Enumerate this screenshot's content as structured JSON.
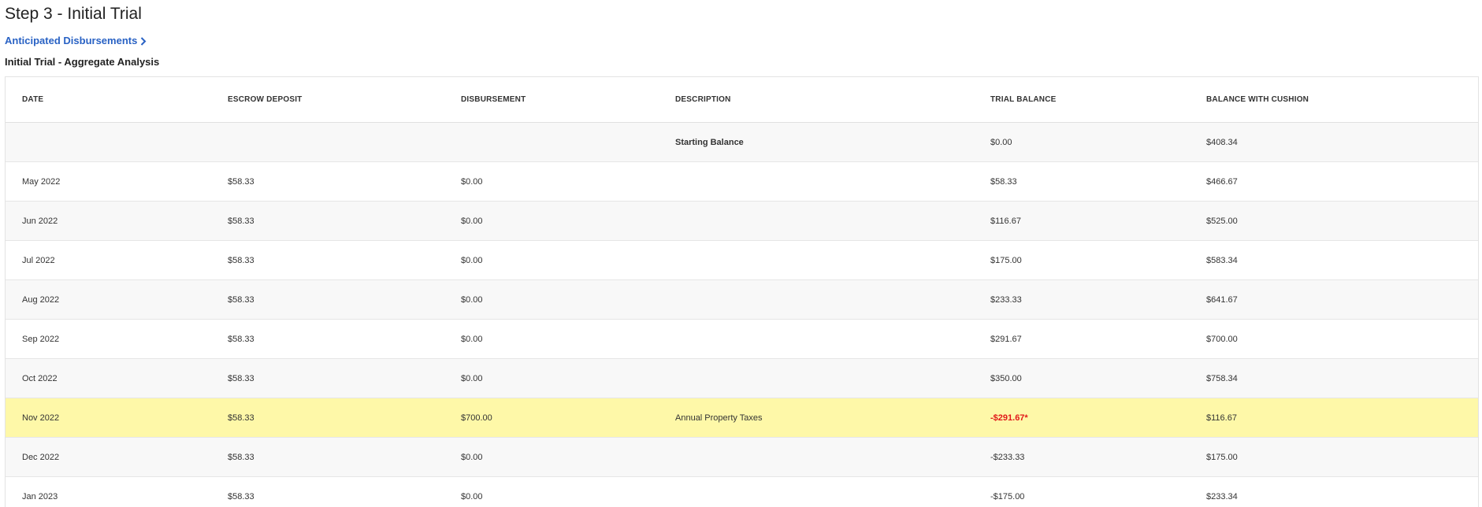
{
  "header": {
    "step_title": "Step 3 - Initial Trial",
    "link_label": "Anticipated Disbursements",
    "section_title": "Initial Trial - Aggregate Analysis"
  },
  "table": {
    "columns": [
      "DATE",
      "ESCROW DEPOSIT",
      "DISBURSEMENT",
      "DESCRIPTION",
      "TRIAL BALANCE",
      "BALANCE WITH CUSHION"
    ],
    "rows": [
      {
        "date": "",
        "deposit": "",
        "disbursement": "",
        "description": "Starting Balance",
        "trial_balance": "$0.00",
        "cushion": "$408.34"
      },
      {
        "date": "May 2022",
        "deposit": "$58.33",
        "disbursement": "$0.00",
        "description": "",
        "trial_balance": "$58.33",
        "cushion": "$466.67"
      },
      {
        "date": "Jun 2022",
        "deposit": "$58.33",
        "disbursement": "$0.00",
        "description": "",
        "trial_balance": "$116.67",
        "cushion": "$525.00"
      },
      {
        "date": "Jul 2022",
        "deposit": "$58.33",
        "disbursement": "$0.00",
        "description": "",
        "trial_balance": "$175.00",
        "cushion": "$583.34"
      },
      {
        "date": "Aug 2022",
        "deposit": "$58.33",
        "disbursement": "$0.00",
        "description": "",
        "trial_balance": "$233.33",
        "cushion": "$641.67"
      },
      {
        "date": "Sep 2022",
        "deposit": "$58.33",
        "disbursement": "$0.00",
        "description": "",
        "trial_balance": "$291.67",
        "cushion": "$700.00"
      },
      {
        "date": "Oct 2022",
        "deposit": "$58.33",
        "disbursement": "$0.00",
        "description": "",
        "trial_balance": "$350.00",
        "cushion": "$758.34"
      },
      {
        "date": "Nov 2022",
        "deposit": "$58.33",
        "disbursement": "$700.00",
        "description": "Annual Property Taxes",
        "trial_balance": "-$291.67*",
        "cushion": "$116.67"
      },
      {
        "date": "Dec 2022",
        "deposit": "$58.33",
        "disbursement": "$0.00",
        "description": "",
        "trial_balance": "-$233.33",
        "cushion": "$175.00"
      },
      {
        "date": "Jan 2023",
        "deposit": "$58.33",
        "disbursement": "$0.00",
        "description": "",
        "trial_balance": "-$175.00",
        "cushion": "$233.34"
      }
    ]
  },
  "colors": {
    "link": "#2962c4",
    "highlight_row": "#fef8a8",
    "alert_text": "#e11919"
  },
  "icons": {
    "link_icon": "chevron-right-icon"
  }
}
